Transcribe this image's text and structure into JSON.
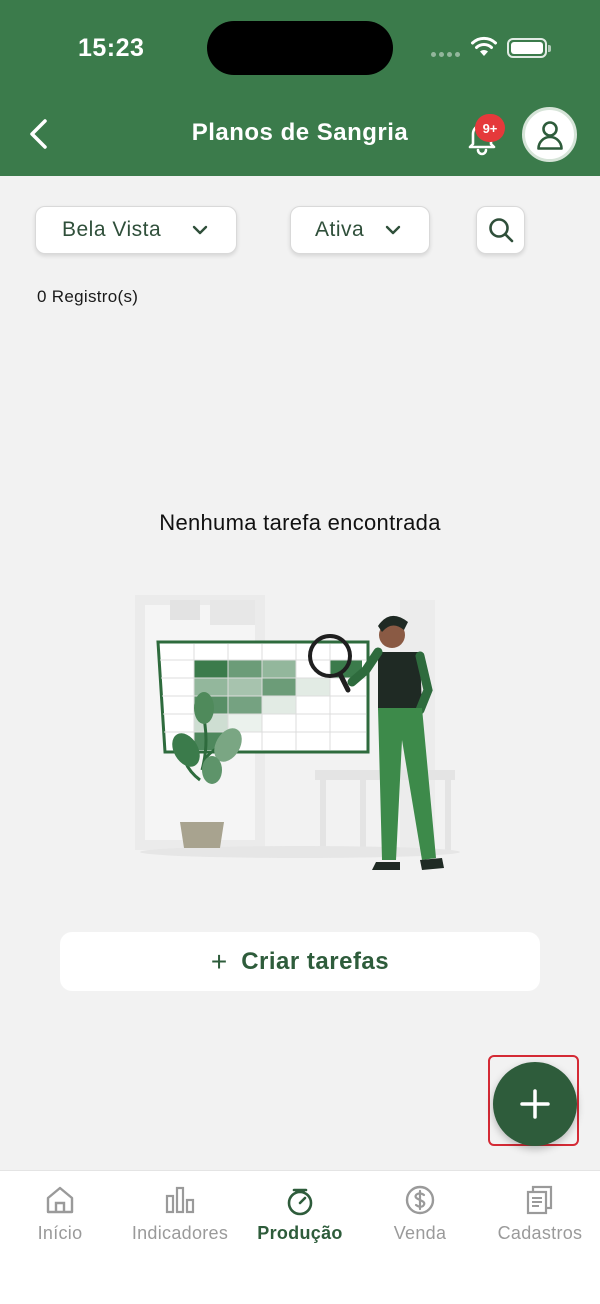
{
  "status_bar": {
    "time": "15:23"
  },
  "header": {
    "title": "Planos de Sangria",
    "notification_badge": "9+"
  },
  "filters": {
    "farm": {
      "selected": "Bela Vista"
    },
    "status": {
      "selected": "Ativa"
    }
  },
  "records": {
    "count_text": "0 Registro(s)"
  },
  "empty_state": {
    "message": "Nenhuma tarefa encontrada"
  },
  "actions": {
    "create_icon": "+",
    "create_label": "Criar tarefas"
  },
  "tabs": [
    {
      "label": "Início",
      "icon": "home-icon",
      "active": false
    },
    {
      "label": "Indicadores",
      "icon": "bar-chart-icon",
      "active": false
    },
    {
      "label": "Produção",
      "icon": "scale-icon",
      "active": true
    },
    {
      "label": "Venda",
      "icon": "dollar-icon",
      "active": false
    },
    {
      "label": "Cadastros",
      "icon": "documents-icon",
      "active": false
    }
  ],
  "colors": {
    "primary": "#3b7b4b",
    "primary_dark": "#2e5c3b",
    "badge": "#e5393b",
    "background": "#f2f2f2"
  }
}
